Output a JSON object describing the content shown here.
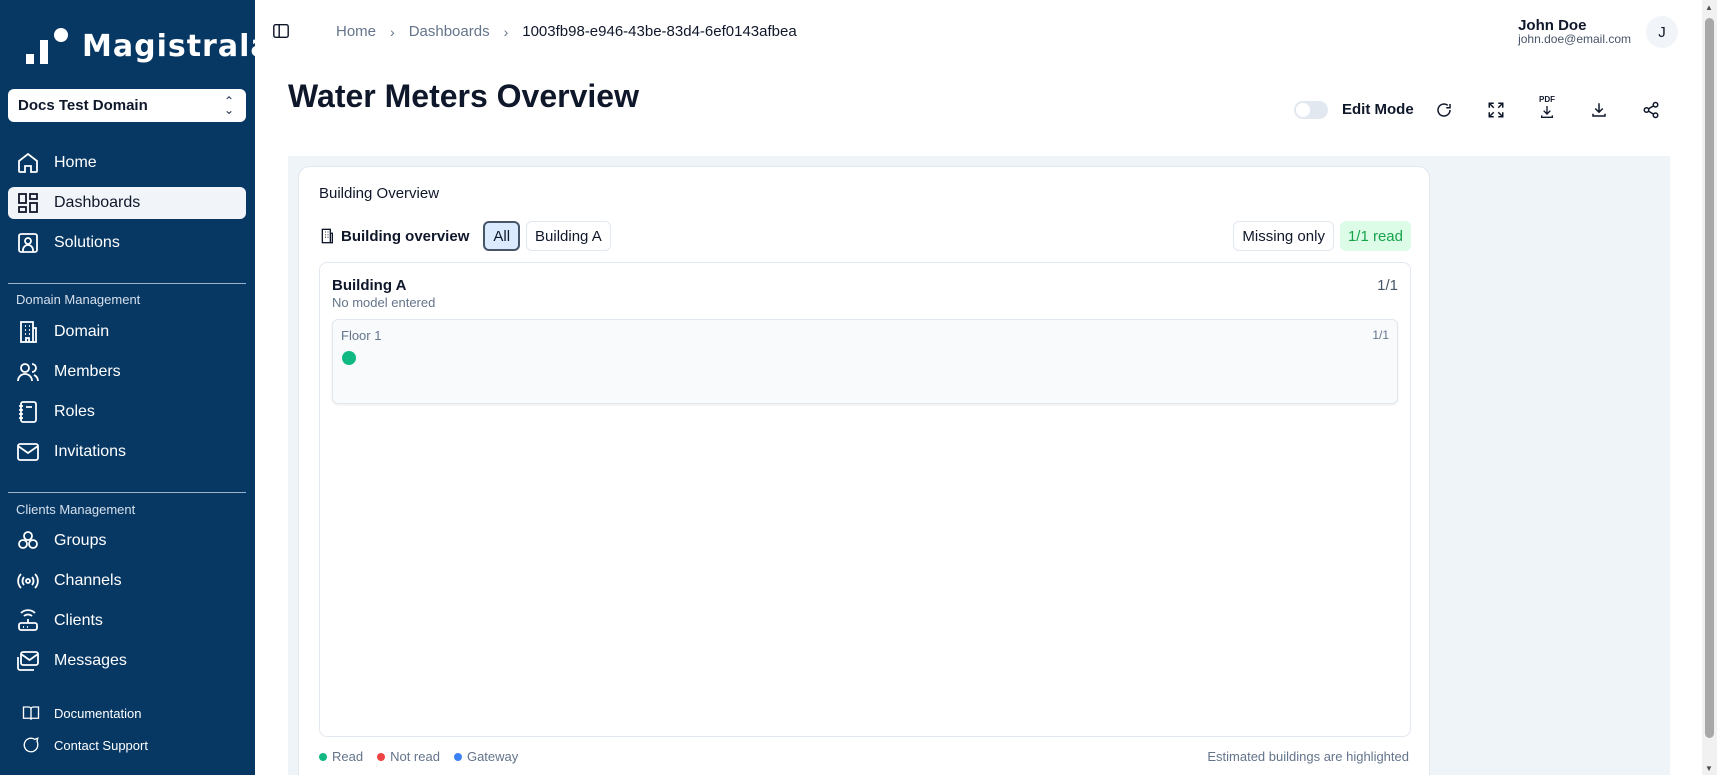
{
  "app": {
    "name": "Magistrala"
  },
  "sidebar": {
    "domain_select": "Docs Test Domain",
    "main_items": [
      {
        "label": "Home",
        "icon": "home-icon"
      },
      {
        "label": "Dashboards",
        "icon": "dashboard-icon",
        "active": true
      },
      {
        "label": "Solutions",
        "icon": "solutions-icon"
      }
    ],
    "domain_section": {
      "title": "Domain Management",
      "items": [
        {
          "label": "Domain",
          "icon": "building-icon"
        },
        {
          "label": "Members",
          "icon": "users-icon"
        },
        {
          "label": "Roles",
          "icon": "notebook-icon"
        },
        {
          "label": "Invitations",
          "icon": "mail-icon"
        }
      ]
    },
    "clients_section": {
      "title": "Clients Management",
      "items": [
        {
          "label": "Groups",
          "icon": "groups-icon"
        },
        {
          "label": "Channels",
          "icon": "radio-icon"
        },
        {
          "label": "Clients",
          "icon": "router-icon"
        },
        {
          "label": "Messages",
          "icon": "messages-icon"
        }
      ]
    },
    "footer_items": [
      {
        "label": "Documentation",
        "icon": "book-icon"
      },
      {
        "label": "Contact Support",
        "icon": "chat-icon"
      }
    ]
  },
  "header": {
    "breadcrumb": [
      "Home",
      "Dashboards",
      "1003fb98-e946-43be-83d4-6ef0143afbea"
    ],
    "user_name": "John Doe",
    "user_email": "john.doe@email.com",
    "avatar_initial": "J"
  },
  "page": {
    "title": "Water Meters Overview",
    "edit_mode_label": "Edit Mode",
    "edit_mode_on": false,
    "pdf_label": "PDF"
  },
  "widget": {
    "title": "Building Overview",
    "toolbar_label": "Building overview",
    "filters": [
      "All",
      "Building A"
    ],
    "active_filter": "All",
    "missing_only_label": "Missing only",
    "read_badge": "1/1 read",
    "building": {
      "name": "Building A",
      "subtitle": "No model entered",
      "count": "1/1",
      "floor": {
        "name": "Floor 1",
        "count": "1/1"
      }
    },
    "legend": [
      {
        "label": "Read",
        "color": "#10b981"
      },
      {
        "label": "Not read",
        "color": "#ef4444"
      },
      {
        "label": "Gateway",
        "color": "#3b82f6"
      }
    ],
    "legend_note": "Estimated buildings are highlighted"
  },
  "colors": {
    "sidebar_bg": "#073763",
    "canvas_bg": "#eef4f8",
    "read_green": "#10b981",
    "badge_green_bg": "#dcfce7"
  }
}
